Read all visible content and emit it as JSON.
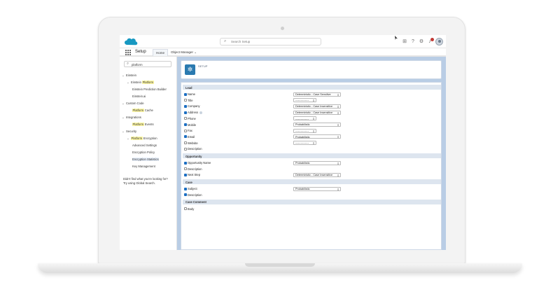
{
  "header": {
    "search_placeholder": "Search Setup",
    "notification_count": "1"
  },
  "nav": {
    "app_title": "Setup",
    "tabs": [
      {
        "label": "Home"
      },
      {
        "label": "Object Manager ⌄"
      }
    ]
  },
  "sidebar": {
    "quick_find_value": "platform",
    "items": [
      {
        "label_pre": "Einstein",
        "label_hl": "",
        "label_post": "",
        "level": 0,
        "chevron": "⌄"
      },
      {
        "label_pre": "Einstein ",
        "label_hl": "Platform",
        "label_post": "",
        "level": 1,
        "chevron": "⌄"
      },
      {
        "label_pre": "Einstein Prediction Builder",
        "label_hl": "",
        "label_post": "",
        "level": 2,
        "chevron": ""
      },
      {
        "label_pre": "Einstein.ai",
        "label_hl": "",
        "label_post": "",
        "level": 2,
        "chevron": ""
      },
      {
        "label_pre": "Custom Code",
        "label_hl": "",
        "label_post": "",
        "level": 0,
        "chevron": "⌄"
      },
      {
        "label_pre": "",
        "label_hl": "Platform",
        "label_post": " Cache",
        "level": 2,
        "chevron": ""
      },
      {
        "label_pre": "Integrations",
        "label_hl": "",
        "label_post": "",
        "level": 0,
        "chevron": "⌄"
      },
      {
        "label_pre": "",
        "label_hl": "Platform",
        "label_post": " Events",
        "level": 2,
        "chevron": ""
      },
      {
        "label_pre": "Security",
        "label_hl": "",
        "label_post": "",
        "level": 0,
        "chevron": "⌄"
      },
      {
        "label_pre": "",
        "label_hl": "Platform",
        "label_post": " Encryption",
        "level": 1,
        "chevron": "⌄"
      },
      {
        "label_pre": "Advanced Settings",
        "label_hl": "",
        "label_post": "",
        "level": 2,
        "chevron": ""
      },
      {
        "label_pre": "Encryption Policy",
        "label_hl": "",
        "label_post": "",
        "level": 2,
        "chevron": ""
      },
      {
        "label_pre": "Encryption Statistics",
        "label_hl": "",
        "label_post": "",
        "level": 2,
        "chevron": "",
        "active": true
      },
      {
        "label_pre": "Key Management",
        "label_hl": "",
        "label_post": "",
        "level": 2,
        "chevron": ""
      }
    ],
    "help_line1": "Didn't find what you're looking for?",
    "help_line2": "Try using Global Search."
  },
  "page": {
    "header_label": "SETUP"
  },
  "sections": [
    {
      "title": "Lead",
      "fields": [
        {
          "label": "Name",
          "checked": true,
          "select": "Deterministic - Case Sensitive",
          "sel_width": "wide"
        },
        {
          "label": "Title",
          "checked": false,
          "select": "---------------",
          "sel_width": "narrow"
        },
        {
          "label": "Company",
          "checked": true,
          "select": "Deterministic - Case Insensitive",
          "sel_width": "wide"
        },
        {
          "label": "Address",
          "checked": true,
          "select": "Deterministic - Case Insensitive",
          "sel_width": "wide",
          "info": true
        },
        {
          "label": "Phone",
          "checked": false,
          "select": "---------------",
          "sel_width": "narrow"
        },
        {
          "label": "Mobile",
          "checked": true,
          "select": "Probabilistic",
          "sel_width": "wide"
        },
        {
          "label": "Fax",
          "checked": false,
          "select": "---------------",
          "sel_width": "narrow"
        },
        {
          "label": "Email",
          "checked": true,
          "select": "Probabilistic",
          "sel_width": "wide"
        },
        {
          "label": "Website",
          "checked": false,
          "select": "---------------",
          "sel_width": "narrow"
        },
        {
          "label": "Description",
          "checked": false,
          "select": "",
          "sel_width": ""
        }
      ]
    },
    {
      "title": "Opportunity",
      "fields": [
        {
          "label": "Opportunity Name",
          "checked": true,
          "select": "Probabilistic",
          "sel_width": "wide"
        },
        {
          "label": "Description",
          "checked": false,
          "select": "",
          "sel_width": ""
        },
        {
          "label": "Next Step",
          "checked": true,
          "select": "Deterministic - Case Insensitive",
          "sel_width": "wide"
        }
      ]
    },
    {
      "title": "Case",
      "fields": [
        {
          "label": "Subject",
          "checked": true,
          "select": "Probabilistic",
          "sel_width": "wide"
        },
        {
          "label": "Description",
          "checked": true,
          "select": "",
          "sel_width": ""
        }
      ]
    },
    {
      "title": "Case Comment",
      "fields": [
        {
          "label": "Body",
          "checked": false,
          "select": "",
          "sel_width": ""
        }
      ]
    }
  ],
  "colors": {
    "brand_blue": "#1798c1",
    "checkbox_on": "#1b6ec2",
    "highlight": "#fff9a6",
    "main_bg": "#b9cde5"
  },
  "icons": [
    "salesforce-cloud-logo",
    "search-icon",
    "add-icon",
    "help-icon",
    "gear-icon",
    "bell-icon",
    "avatar",
    "waffle-icon",
    "chevron-down-icon",
    "setup-gear-icon"
  ]
}
